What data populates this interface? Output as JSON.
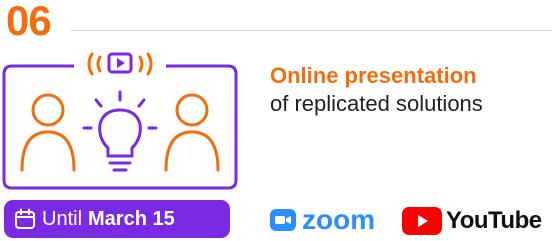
{
  "step": {
    "number": "06"
  },
  "event": {
    "title": "Online presentation",
    "subtitle": "of replicated solutions"
  },
  "deadline": {
    "prefix": "Until",
    "date": "March 15"
  },
  "platforms": {
    "zoom_label": "zoom",
    "youtube_label": "YouTube"
  },
  "icons": {
    "illustration": "presentation-people-lightbulb-icon",
    "calendar": "calendar-icon",
    "zoom": "zoom-camera-icon",
    "youtube": "youtube-play-icon"
  },
  "colors": {
    "accent_orange": "#f26d0f",
    "accent_purple": "#7a2ae2",
    "zoom_blue": "#2d8cff",
    "youtube_red": "#ff0000"
  }
}
